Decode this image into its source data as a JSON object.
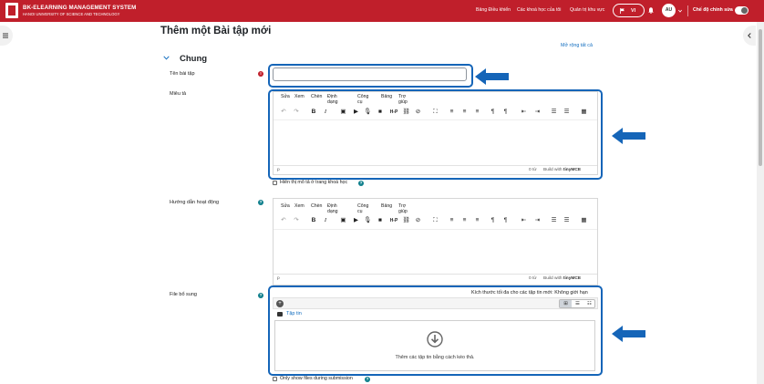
{
  "navbar": {
    "brand_title": "BK-ELEARNING MANAGEMENT SYSTEM",
    "brand_subtitle": "HANOI UNIVERSITY OF SCIENCE AND TECHNOLOGY",
    "links": [
      "Bảng Điều khiển",
      "Các khoá học của tôi",
      "Quản trị khu vực"
    ],
    "language": "VI",
    "avatar": "AU",
    "edit_mode_label": "Chế độ chỉnh sửa"
  },
  "page": {
    "title": "Thêm một Bài tập mới",
    "expand_all": "Mở rộng tất cả",
    "section_title": "Chung"
  },
  "fields": {
    "name_label": "Tên bài tập",
    "description_label": "Miêu tả",
    "show_description_label": "Hiển thị mô tả ở trang khoá học",
    "activity_instructions_label": "Hướng dẫn hoạt động",
    "additional_files_label": "File bổ sung",
    "only_show_files_label": "Only show files during submission"
  },
  "editor": {
    "menus": [
      "Sửa",
      "Xem",
      "Chèn",
      "Định dạng",
      "Công cụ",
      "Bảng",
      "Trợ giúp"
    ],
    "status_path": "p",
    "word_count": "0 từ",
    "build_with": "Build with",
    "tinymce": "tinyMCE"
  },
  "file_picker": {
    "max_size": "Kích thước tối đa cho các tập tin mới: Không giới hạn",
    "folder_label": "Tập tin",
    "drop_text": "Thêm các tập tin bằng cách kéo thả."
  },
  "icons": {
    "required": "!",
    "help": "?",
    "add": "+"
  },
  "colors": {
    "brand_red": "#c01f2b",
    "highlight_blue": "#1565b8",
    "link_blue": "#0f6cbf"
  }
}
